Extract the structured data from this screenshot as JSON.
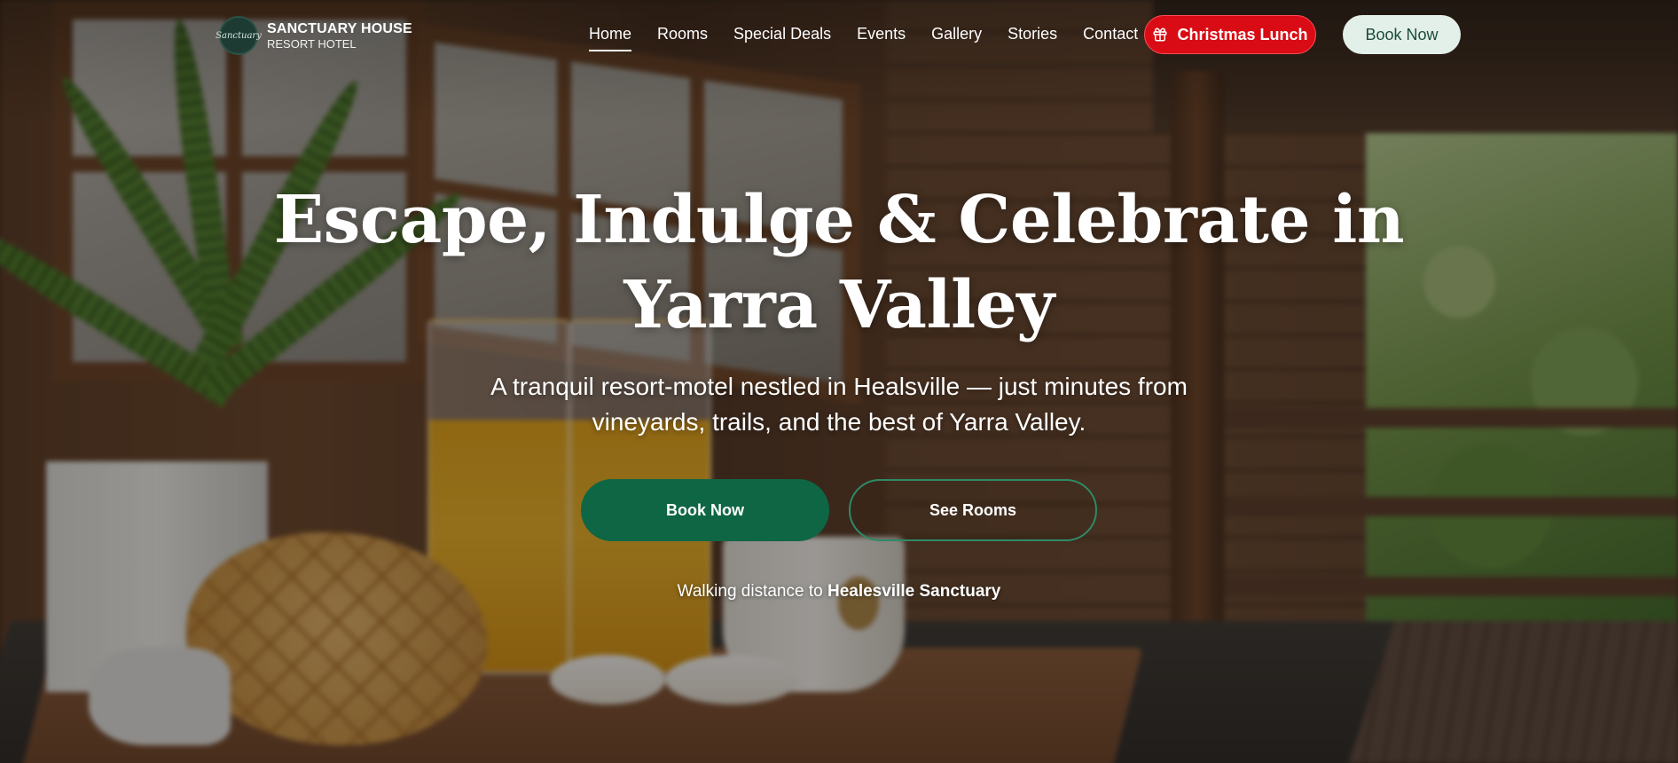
{
  "brand": {
    "logo_text": "Sanctuary",
    "name": "SANCTUARY HOUSE",
    "subtitle": "RESORT HOTEL"
  },
  "nav": {
    "items": [
      {
        "label": "Home",
        "active": true
      },
      {
        "label": "Rooms",
        "active": false
      },
      {
        "label": "Special Deals",
        "active": false
      },
      {
        "label": "Events",
        "active": false
      },
      {
        "label": "Gallery",
        "active": false
      },
      {
        "label": "Stories",
        "active": false
      },
      {
        "label": "Contact",
        "active": false
      }
    ],
    "christmas_button": {
      "label": "Christmas Lunch",
      "icon": "gift-icon",
      "color": "#d90b14"
    },
    "book_button": {
      "label": "Book Now",
      "color": "#e3efe9"
    }
  },
  "hero": {
    "title": "Escape, Indulge & Celebrate in Yarra Valley",
    "subtitle": "A tranquil resort-motel nestled in Healsville — just minutes from vineyards, trails, and the best of Yarra Valley.",
    "primary_button": "Book Now",
    "secondary_button": "See Rooms",
    "note_prefix": "Walking distance to",
    "note_highlight": "Healesville Sanctuary"
  },
  "colors": {
    "accent_green": "#0f6645",
    "christmas_red": "#d90b14",
    "light_green": "#e3efe9"
  }
}
